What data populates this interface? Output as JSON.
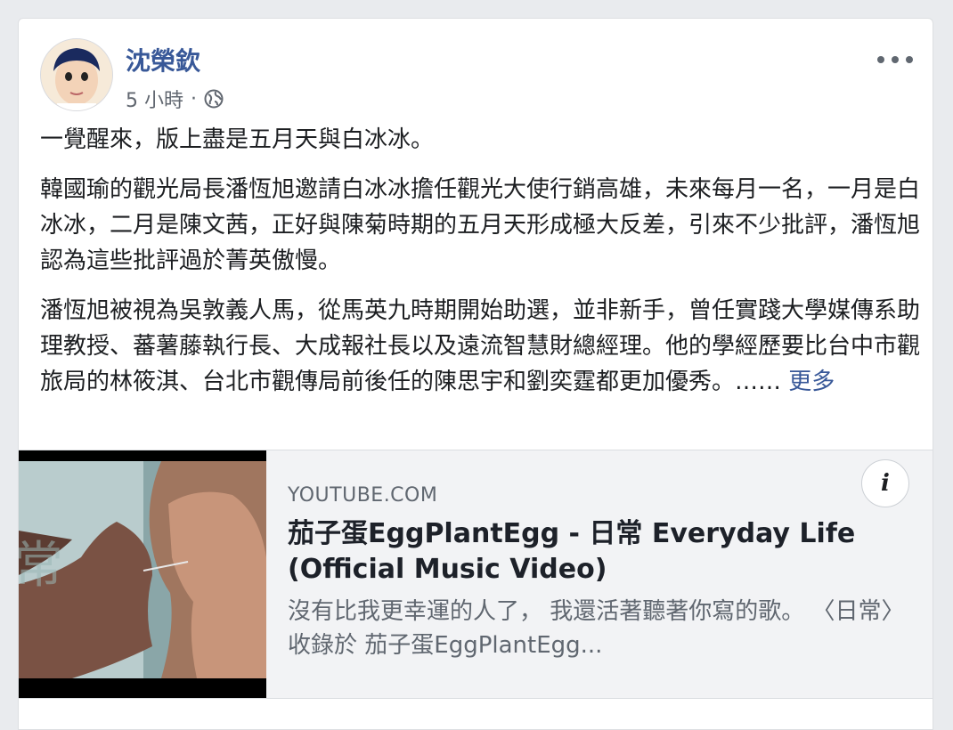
{
  "post": {
    "author": "沈榮欽",
    "time": "5 小時",
    "separator": "·",
    "privacy_icon": "globe-icon",
    "paragraphs": [
      "一覺醒來，版上盡是五月天與白冰冰。",
      "韓國瑜的觀光局長潘恆旭邀請白冰冰擔任觀光大使行銷高雄，未來每月一名，一月是白冰冰，二月是陳文茜，正好與陳菊時期的五月天形成極大反差，引來不少批評，潘恆旭認為這些批評過於菁英傲慢。",
      "潘恆旭被視為吳敦義人馬，從馬英九時期開始助選，並非新手，曾任實踐大學媒傳系助理教授、蕃薯藤執行長、大成報社長以及遠流智慧財總經理。他的學經歷要比台中市觀旅局的林筱淇、台北市觀傳局前後任的陳思宇和劉奕霆都更加優秀。……"
    ],
    "see_more": "更多"
  },
  "link": {
    "domain": "YOUTUBE.COM",
    "title": "茄子蛋EggPlantEgg - 日常 Everyday Life (Official Music Video)",
    "description": "沒有比我更幸運的人了， 我還活著聽著你寫的歌。 〈日常〉 收錄於 茄子蛋EggPlantEgg...",
    "info_label": "i",
    "thumbnail_text": "常"
  },
  "colors": {
    "author": "#385898",
    "meta": "#616770",
    "link_bg": "#f2f3f5"
  }
}
